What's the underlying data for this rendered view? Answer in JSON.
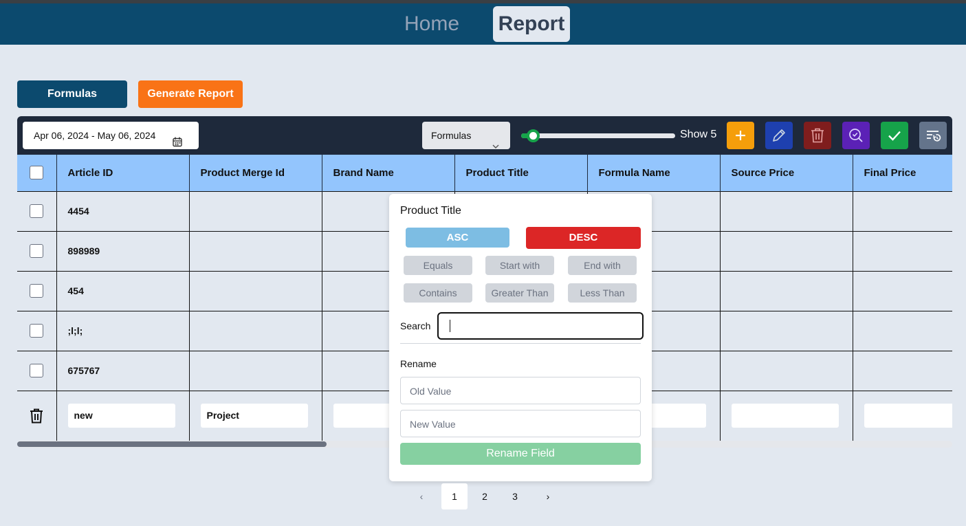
{
  "nav": {
    "home": "Home",
    "report": "Report"
  },
  "actions": {
    "formulas": "Formulas",
    "generate_report": "Generate Report"
  },
  "toolbar": {
    "date_range": "Apr 06, 2024 - May 06, 2024",
    "formula_select": "Formulas",
    "show_label": "Show 5",
    "rows_shown": 5,
    "buttons": {
      "add": {
        "icon": "plus-icon",
        "color": "#f59e0b"
      },
      "edit": {
        "icon": "pencil-icon",
        "color": "#1e40af"
      },
      "delete": {
        "icon": "trash-icon",
        "color": "#7f1d1d"
      },
      "search": {
        "icon": "search-icon",
        "color": "#5b21b6"
      },
      "confirm": {
        "icon": "check-icon",
        "color": "#16a34a"
      },
      "reset": {
        "icon": "filter-reset-icon",
        "color": "#64748b"
      }
    }
  },
  "table": {
    "columns": [
      "Article ID",
      "Product Merge Id",
      "Brand Name",
      "Product Title",
      "Formula Name",
      "Source Price",
      "Final Price"
    ],
    "rows": [
      [
        "4454",
        "",
        "",
        "",
        "",
        "",
        ""
      ],
      [
        "898989",
        "",
        "",
        "",
        "",
        "",
        ""
      ],
      [
        "454",
        "",
        "",
        "",
        "",
        "",
        ""
      ],
      [
        ";l;l;",
        "",
        "",
        "",
        "",
        "",
        ""
      ],
      [
        "675767",
        "",
        "",
        "",
        "",
        "",
        ""
      ]
    ],
    "new_row": [
      "new",
      "Project",
      "",
      "",
      "",
      "",
      ""
    ]
  },
  "popup": {
    "title": "Product Title",
    "asc": "ASC",
    "desc": "DESC",
    "filters": [
      "Equals",
      "Start with",
      "End with",
      "Contains",
      "Greater Than",
      "Less Than"
    ],
    "search_label": "Search",
    "search_value": "",
    "rename_label": "Rename",
    "old_value_placeholder": "Old Value",
    "new_value_placeholder": "New Value",
    "rename_button": "Rename Field"
  },
  "pagination": {
    "pages": [
      "1",
      "2",
      "3"
    ],
    "current": "1",
    "prev": "‹",
    "next": "›"
  }
}
